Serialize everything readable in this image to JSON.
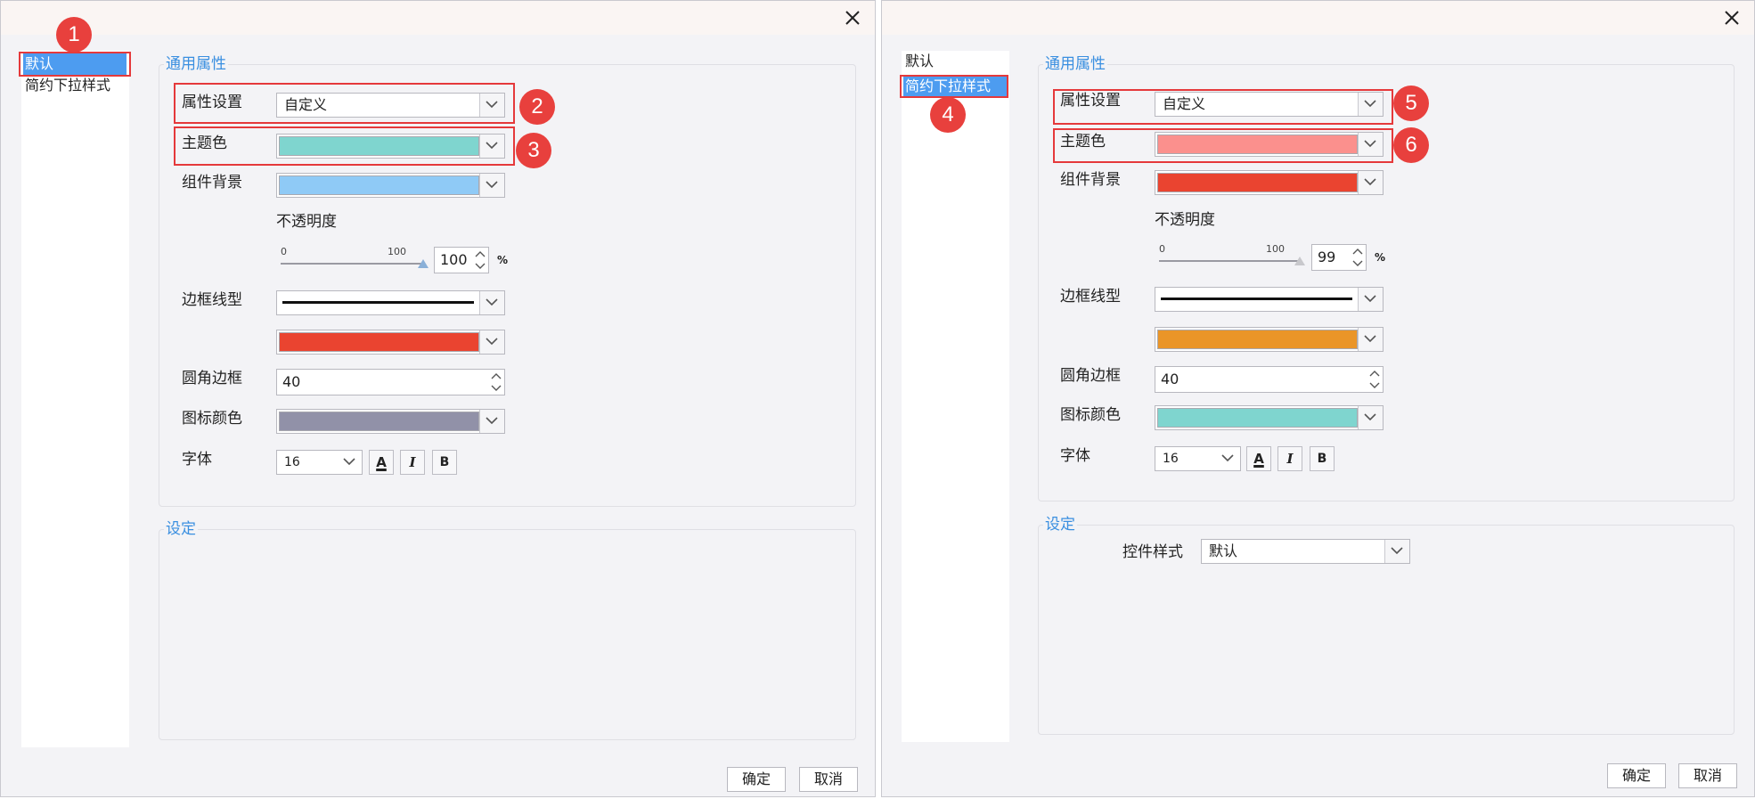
{
  "left_dialog": {
    "sidebar": {
      "items": [
        {
          "label": "默认",
          "active": true
        },
        {
          "label": "简约下拉样式",
          "active": false
        }
      ]
    },
    "general_group_title": "通用属性",
    "settings_group_title": "设定",
    "property_setting": {
      "label": "属性设置",
      "value": "自定义"
    },
    "theme_color": {
      "label": "主题色",
      "color": "#7fd5cf"
    },
    "component_background": {
      "label": "组件背景",
      "color": "#8fcaf6"
    },
    "opacity": {
      "label": "不透明度",
      "min": "0",
      "max": "100",
      "value": "100",
      "unit": "%",
      "level": 1.0
    },
    "border_line": {
      "label": "边框线型",
      "color": "#ea4430"
    },
    "corner_border": {
      "label": "圆角边框",
      "value": "40"
    },
    "icon_color": {
      "label": "图标颜色",
      "color": "#9191a8"
    },
    "font": {
      "label": "字体",
      "size": "16",
      "color_btn": "A",
      "italic_btn": "I",
      "bold_btn": "B"
    },
    "buttons": {
      "ok": "确定",
      "cancel": "取消"
    },
    "callouts": [
      "1",
      "2",
      "3"
    ]
  },
  "right_dialog": {
    "sidebar": {
      "items": [
        {
          "label": "默认",
          "active": false
        },
        {
          "label": "简约下拉样式",
          "active": true
        }
      ]
    },
    "general_group_title": "通用属性",
    "settings_group_title": "设定",
    "property_setting": {
      "label": "属性设置",
      "value": "自定义"
    },
    "theme_color": {
      "label": "主题色",
      "color": "#fb908d"
    },
    "component_background": {
      "label": "组件背景",
      "color": "#ea4430"
    },
    "opacity": {
      "label": "不透明度",
      "min": "0",
      "max": "100",
      "value": "99",
      "unit": "%",
      "level": 0.99
    },
    "border_line": {
      "label": "边框线型",
      "color": "#ea9528"
    },
    "corner_border": {
      "label": "圆角边框",
      "value": "40"
    },
    "icon_color": {
      "label": "图标颜色",
      "color": "#7fd5cf"
    },
    "font": {
      "label": "字体",
      "size": "16",
      "color_btn": "A",
      "italic_btn": "I",
      "bold_btn": "B"
    },
    "control_style": {
      "label": "控件样式",
      "value": "默认"
    },
    "buttons": {
      "ok": "确定",
      "cancel": "取消"
    },
    "callouts": [
      "4",
      "5",
      "6"
    ]
  },
  "colors": {
    "accent": "#3a8fe0",
    "selection": "#4d9cf0",
    "highlight_box": "#e5393b",
    "callout": "#e8403d"
  },
  "icons": [
    "close-icon",
    "chevron-down-icon",
    "spin-up-icon",
    "spin-down-icon"
  ]
}
